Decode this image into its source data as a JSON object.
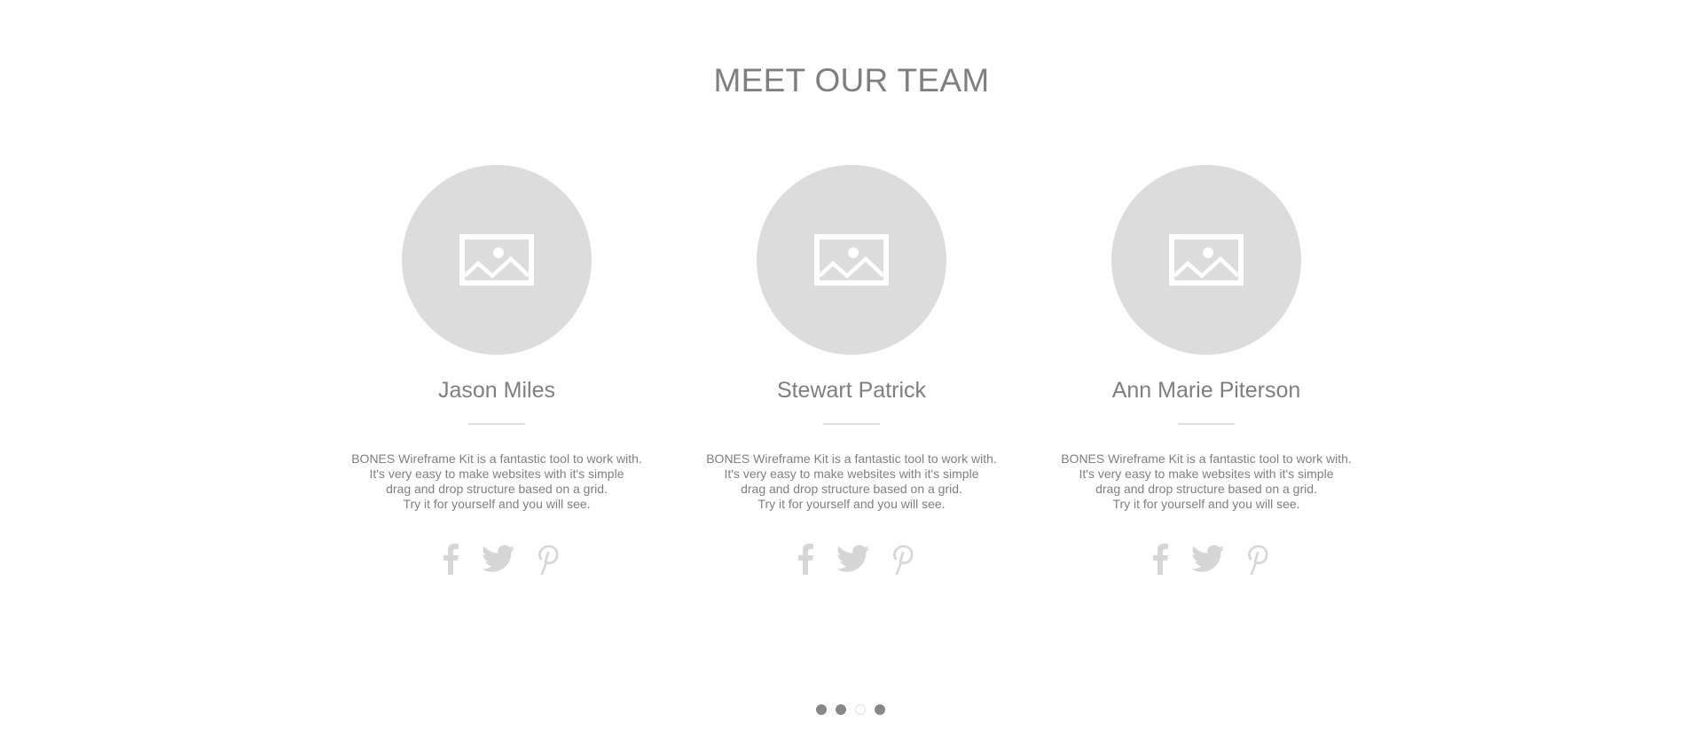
{
  "section": {
    "title": "MEET OUR TEAM"
  },
  "team": [
    {
      "name": "Jason Miles",
      "avatar_icon": "image-placeholder-icon",
      "bio_lines": [
        "BONES Wireframe Kit is a fantastic tool to work with.",
        "It's very easy to make websites with it's simple",
        "drag and drop structure based on a grid.",
        "Try it for yourself and you will see."
      ],
      "social": [
        "facebook-icon",
        "twitter-icon",
        "pinterest-icon"
      ]
    },
    {
      "name": "Stewart Patrick",
      "avatar_icon": "image-placeholder-icon",
      "bio_lines": [
        "BONES Wireframe Kit is a fantastic tool to work with.",
        "It's very easy to make websites with it's simple",
        "drag and drop structure based on a grid.",
        "Try it for yourself and you will see."
      ],
      "social": [
        "facebook-icon",
        "twitter-icon",
        "pinterest-icon"
      ]
    },
    {
      "name": "Ann Marie Piterson",
      "avatar_icon": "image-placeholder-icon",
      "bio_lines": [
        "BONES Wireframe Kit is a fantastic tool to work with.",
        "It's very easy to make websites with it's simple",
        "drag and drop structure based on a grid.",
        "Try it for yourself and you will see."
      ],
      "social": [
        "facebook-icon",
        "twitter-icon",
        "pinterest-icon"
      ]
    }
  ],
  "pagination": {
    "total": 4,
    "active_index": 2
  },
  "colors": {
    "text": "#7f7f7f",
    "placeholder": "#dcdcdc",
    "social_icon": "#d6d6d6",
    "divider": "#dddddd",
    "dot": "#888888"
  }
}
